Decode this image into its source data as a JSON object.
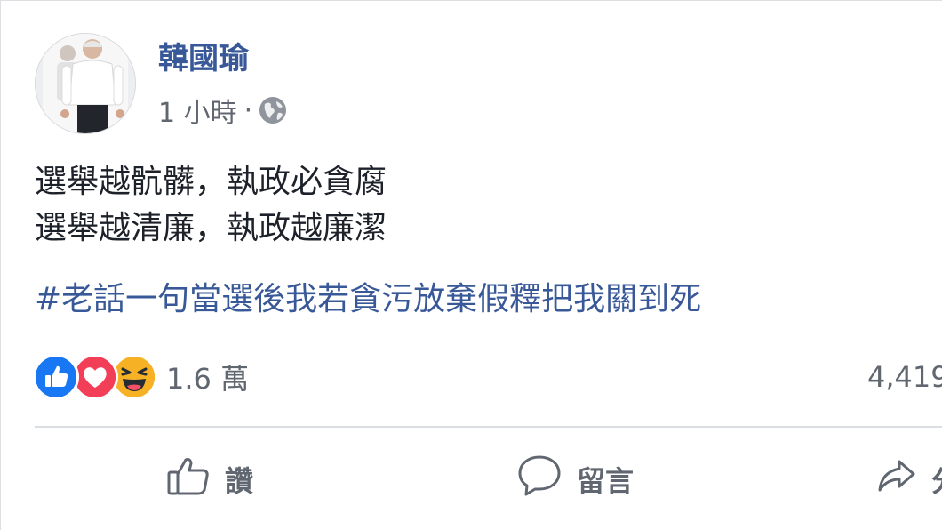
{
  "post": {
    "author": "韓國瑜",
    "timestamp": "1 小時",
    "meta_separator": "·",
    "privacy_icon": "globe-icon",
    "text_lines": [
      "選舉越骯髒，執政必貪腐",
      "選舉越清廉，執政越廉潔"
    ],
    "hashtag": "#老話一句當選後我若貪污放棄假釋把我關到死"
  },
  "reactions": {
    "icons": [
      "like-reaction-icon",
      "love-reaction-icon",
      "haha-reaction-icon"
    ],
    "count": "1.6 萬",
    "comments_count": "4,419"
  },
  "actions": {
    "like_label": "讚",
    "comment_label": "留言",
    "share_label": "分享"
  },
  "colors": {
    "name_blue": "#385898",
    "like_blue": "#1877f2",
    "love_red": "#f33e58",
    "haha_yellow": "#f7b125",
    "meta_gray": "#616770"
  }
}
